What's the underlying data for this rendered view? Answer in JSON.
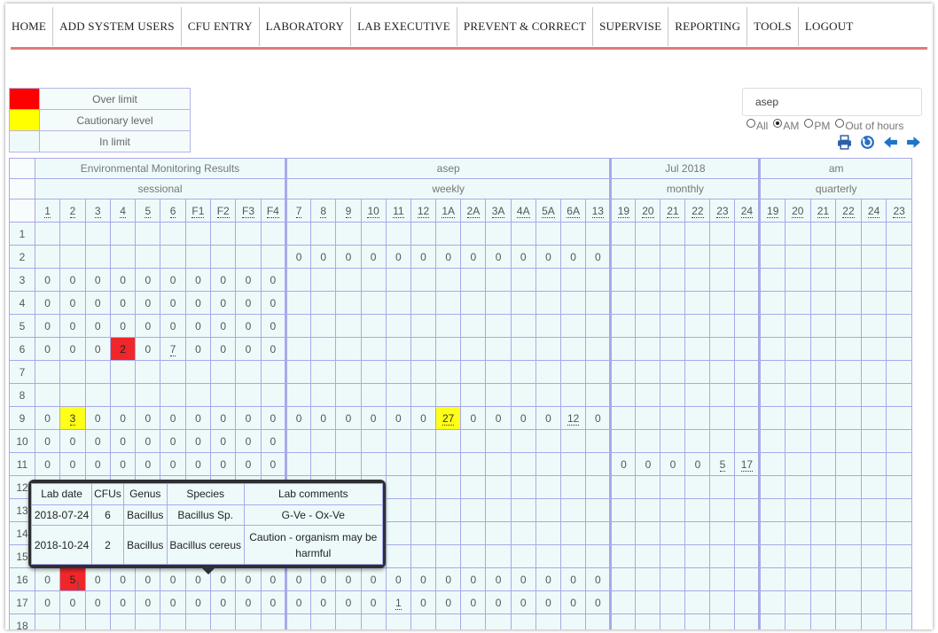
{
  "nav": [
    "HOME",
    "ADD SYSTEM USERS",
    "CFU ENTRY",
    "LABORATORY",
    "LAB EXECUTIVE",
    "PREVENT & CORRECT",
    "SUPERVISE",
    "REPORTING",
    "TOOLS",
    "LOGOUT"
  ],
  "legend": [
    {
      "label": "Over limit",
      "color": "#ff0000"
    },
    {
      "label": "Cautionary level",
      "color": "#ffff00"
    },
    {
      "label": "In limit",
      "color": "#eefafa"
    }
  ],
  "search": {
    "value": "asep"
  },
  "radios": [
    {
      "label": "All",
      "checked": false
    },
    {
      "label": "AM",
      "checked": true
    },
    {
      "label": "PM",
      "checked": false
    },
    {
      "label": "Out of hours",
      "checked": false
    }
  ],
  "toolbar": [
    "print-icon",
    "refresh-icon",
    "arrow-left-icon",
    "arrow-right-icon"
  ],
  "grid": {
    "header1": [
      "Environmental Monitoring Results",
      "asep",
      "Jul 2018",
      "am"
    ],
    "header2": [
      "sessional",
      "weekly",
      "monthly",
      "quarterly"
    ],
    "groups": [
      {
        "cols": [
          "1",
          "2",
          "3",
          "4",
          "5",
          "6",
          "F1",
          "F2",
          "F3",
          "F4"
        ]
      },
      {
        "cols": [
          "7",
          "8",
          "9",
          "10",
          "11",
          "12",
          "1A",
          "2A",
          "3A",
          "4A",
          "5A",
          "6A",
          "13"
        ]
      },
      {
        "cols": [
          "19",
          "20",
          "21",
          "22",
          "23",
          "24"
        ]
      },
      {
        "cols": [
          "19",
          "20",
          "21",
          "22",
          "24",
          "23"
        ]
      }
    ],
    "rows": [
      {
        "label": "1",
        "g": [
          null,
          null,
          null,
          null
        ]
      },
      {
        "label": "2",
        "g": [
          null,
          [
            "0",
            "0",
            "0",
            "0",
            "0",
            "0",
            "0",
            "0",
            "0",
            "0",
            "0",
            "0",
            "0"
          ],
          null,
          null
        ]
      },
      {
        "label": "3",
        "g": [
          [
            "0",
            "0",
            "0",
            "0",
            "0",
            "0",
            "0",
            "0",
            "0",
            "0"
          ],
          null,
          null,
          null
        ]
      },
      {
        "label": "4",
        "g": [
          [
            "0",
            "0",
            "0",
            "0",
            "0",
            "0",
            "0",
            "0",
            "0",
            "0"
          ],
          null,
          null,
          null
        ]
      },
      {
        "label": "5",
        "g": [
          [
            "0",
            "0",
            "0",
            "0",
            "0",
            "0",
            "0",
            "0",
            "0",
            "0"
          ],
          null,
          null,
          null
        ]
      },
      {
        "label": "6",
        "g": [
          [
            "0",
            "0",
            "0",
            "2",
            "0",
            "7",
            "0",
            "0",
            "0",
            "0"
          ],
          null,
          null,
          null
        ]
      },
      {
        "label": "7",
        "g": [
          null,
          null,
          null,
          null
        ]
      },
      {
        "label": "8",
        "g": [
          null,
          null,
          null,
          null
        ]
      },
      {
        "label": "9",
        "g": [
          [
            "0",
            "3",
            "0",
            "0",
            "0",
            "0",
            "0",
            "0",
            "0",
            "0"
          ],
          [
            "0",
            "0",
            "0",
            "0",
            "0",
            "0",
            "27",
            "0",
            "0",
            "0",
            "0",
            "12",
            "0"
          ],
          null,
          null
        ]
      },
      {
        "label": "10",
        "g": [
          [
            "0",
            "0",
            "0",
            "0",
            "0",
            "0",
            "0",
            "0",
            "0",
            "0"
          ],
          null,
          null,
          null
        ]
      },
      {
        "label": "11",
        "g": [
          [
            "0",
            "0",
            "0",
            "0",
            "0",
            "0",
            "0",
            "0",
            "0",
            "0"
          ],
          null,
          [
            "0",
            "0",
            "0",
            "0",
            "5",
            "17"
          ],
          null
        ]
      },
      {
        "label": "12",
        "g": [
          null,
          null,
          null,
          null
        ]
      },
      {
        "label": "13",
        "g": [
          null,
          null,
          null,
          null
        ]
      },
      {
        "label": "14",
        "g": [
          null,
          null,
          null,
          null
        ]
      },
      {
        "label": "15",
        "g": [
          null,
          null,
          null,
          null
        ]
      },
      {
        "label": "16",
        "g": [
          [
            "0",
            "5",
            "0",
            "0",
            "0",
            "0",
            "0",
            "0",
            "0",
            "0"
          ],
          [
            "0",
            "0",
            "0",
            "0",
            "0",
            "0",
            "0",
            "0",
            "0",
            "0",
            "0",
            "0",
            "0"
          ],
          null,
          null
        ]
      },
      {
        "label": "17",
        "g": [
          [
            "0",
            "0",
            "0",
            "0",
            "0",
            "0",
            "0",
            "0",
            "0",
            "0"
          ],
          [
            "0",
            "0",
            "0",
            "0",
            "1",
            "0",
            "0",
            "0",
            "0",
            "0",
            "0",
            "0",
            "0"
          ],
          null,
          null
        ]
      },
      {
        "label": "18",
        "g": [
          null,
          null,
          null,
          null
        ]
      }
    ]
  },
  "tooltip": {
    "headers": [
      "Lab date",
      "CFUs",
      "Genus",
      "Species",
      "Lab comments"
    ],
    "rows": [
      [
        "2018-07-24",
        "6",
        "Bacillus",
        "Bacillus Sp.",
        "G-Ve - Ox-Ve"
      ],
      [
        "2018-10-24",
        "2",
        "Bacillus",
        "Bacillus cereus",
        "Caution - organism may be harmful"
      ]
    ]
  }
}
